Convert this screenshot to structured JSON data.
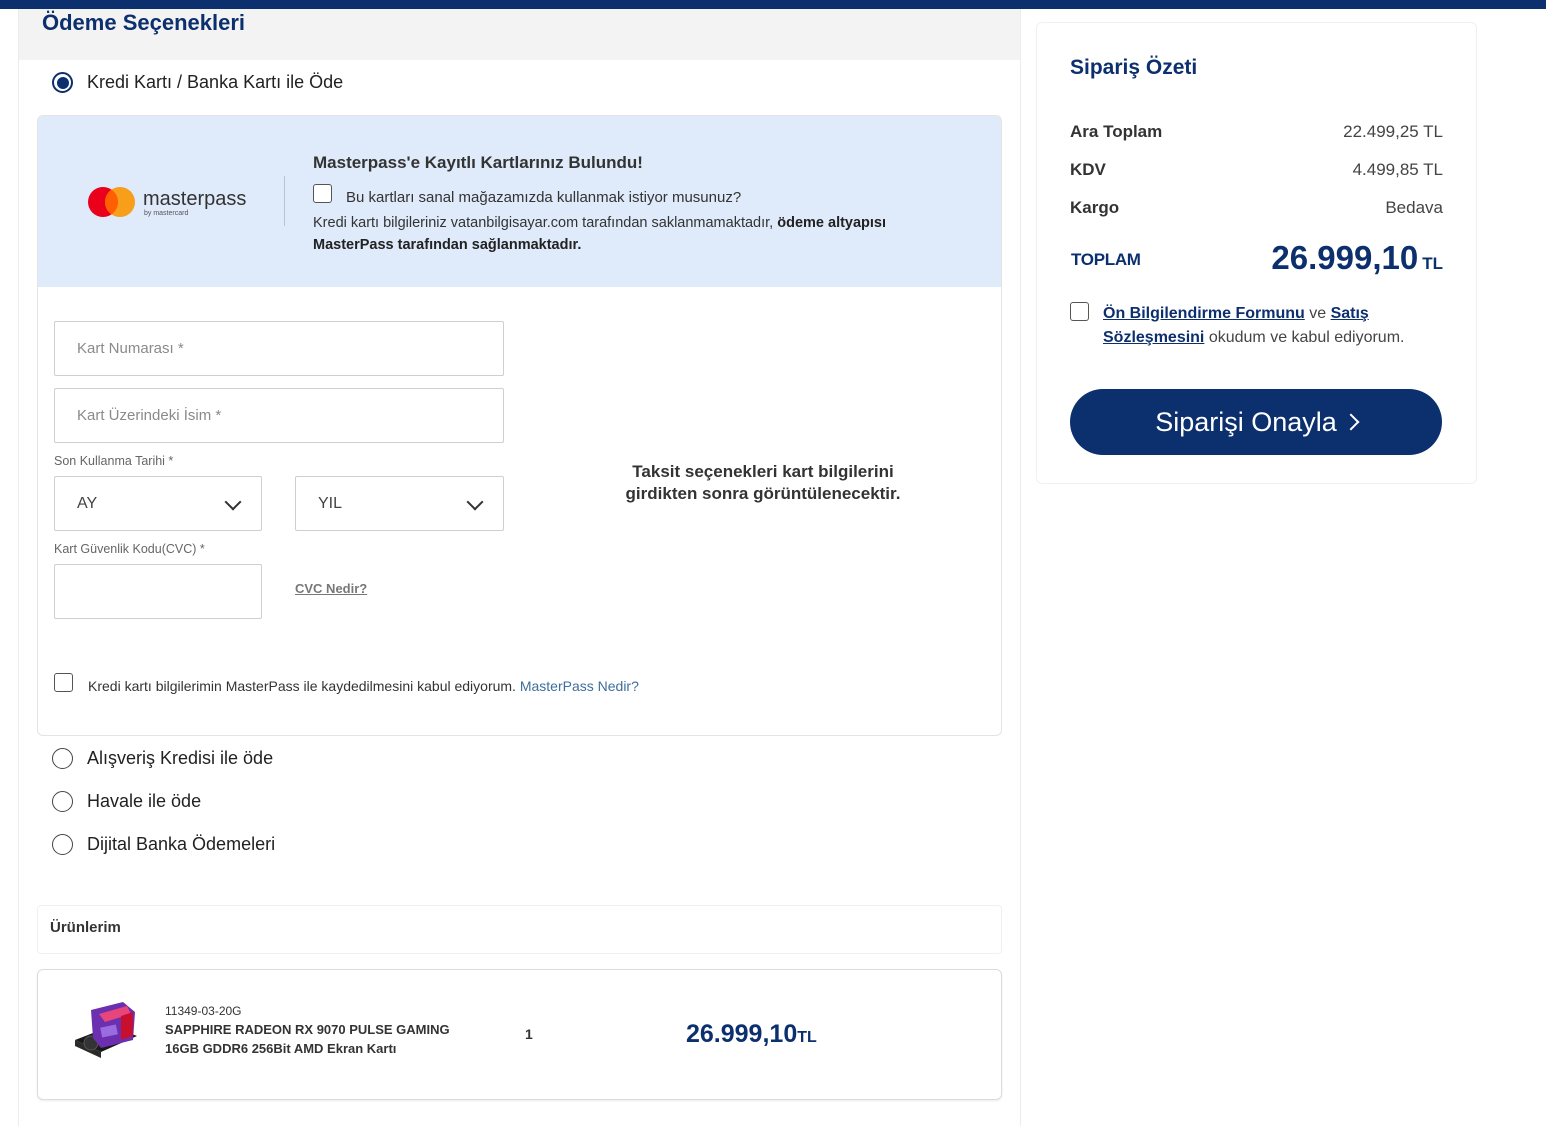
{
  "payment": {
    "title": "Ödeme Seçenekleri",
    "options": [
      {
        "label": "Kredi Kartı / Banka Kartı ile Öde",
        "selected": true
      },
      {
        "label": "Alışveriş Kredisi ile öde",
        "selected": false
      },
      {
        "label": "Havale ile öde",
        "selected": false
      },
      {
        "label": "Dijital Banka Ödemeleri",
        "selected": false
      }
    ]
  },
  "masterpass": {
    "logo_text": "masterpass",
    "logo_sub": "by mastercard",
    "title": "Masterpass'e Kayıtlı Kartlarınız Bulundu!",
    "question": "Bu kartları sanal mağazamızda kullanmak istiyor musunuz?",
    "note_plain": "Kredi kartı bilgileriniz vatanbilgisayar.com tarafından saklanmamaktadır, ",
    "note_bold": "ödeme altyapısı MasterPass tarafından sağlanmaktadır."
  },
  "card_form": {
    "card_number_placeholder": "Kart Numarası *",
    "card_name_placeholder": "Kart Üzerindeki İsim *",
    "expiry_label": "Son Kullanma Tarihi *",
    "month_value": "AY",
    "year_value": "YIL",
    "cvc_label": "Kart Güvenlik Kodu(CVC) *",
    "cvc_link": "CVC Nedir?",
    "installment_note": "Taksit seçenekleri kart bilgilerini girdikten sonra görüntülenecektir.",
    "mp_accept_text": "Kredi kartı bilgilerimin MasterPass ile kaydedilmesini kabul ediyorum.",
    "mp_accept_link": "MasterPass Nedir?"
  },
  "products": {
    "header": "Ürünlerim",
    "items": [
      {
        "sku": "11349-03-20G",
        "name": "SAPPHIRE RADEON RX 9070 PULSE GAMING 16GB GDDR6 256Bit AMD Ekran Kartı",
        "quantity": "1",
        "price": "26.999,10",
        "currency": "TL"
      }
    ]
  },
  "summary": {
    "title": "Sipariş Özeti",
    "subtotal_label": "Ara Toplam",
    "subtotal_value": "22.499,25 TL",
    "tax_label": "KDV",
    "tax_value": "4.499,85 TL",
    "shipping_label": "Kargo",
    "shipping_value": "Bedava",
    "total_label": "TOPLAM",
    "total_value": "26.999,10",
    "total_currency": "TL",
    "agree_link1": "Ön Bilgilendirme Formunu",
    "agree_mid": " ve ",
    "agree_link2": "Satış Sözleşmesini",
    "agree_tail": " okudum ve kabul ediyorum.",
    "confirm_button": "Siparişi Onayla"
  },
  "colors": {
    "brand": "#0c2f6e",
    "banner": "#dfeafa",
    "mastercard_red": "#eb001b",
    "mastercard_orange": "#f79e1b"
  }
}
